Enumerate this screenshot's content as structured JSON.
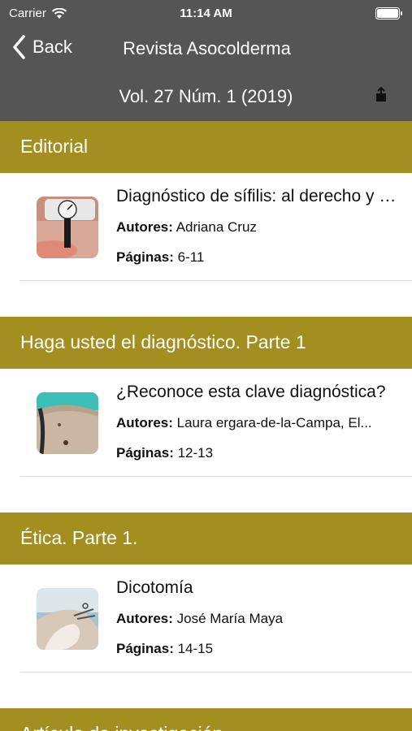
{
  "status_bar": {
    "carrier": "Carrier",
    "time": "11:14 AM"
  },
  "nav": {
    "back_label": "Back",
    "title": "Revista Asocolderma"
  },
  "issue": {
    "title": "Vol. 27 Núm. 1 (2019)"
  },
  "labels": {
    "authors": "Autores:",
    "pages": "Páginas:"
  },
  "sections": [
    {
      "title": "Editorial",
      "article": {
        "title": "Diagnóstico de sífilis: al derecho y al revés",
        "authors": "Adriana Cruz",
        "pages": "6-11"
      }
    },
    {
      "title": "Haga usted el diagnóstico. Parte 1",
      "article": {
        "title": "¿Reconoce esta clave diagnóstica?",
        "authors": "Laura ergara-de-la-Campa, El...",
        "pages": "12-13"
      }
    },
    {
      "title": "Ética. Parte 1.",
      "article": {
        "title": "Dicotomía",
        "authors": "José María Maya",
        "pages": "14-15"
      }
    },
    {
      "title": "Artículo de investigación"
    }
  ],
  "colors": {
    "header_bg": "#555555",
    "section_bg": "#a38e1f"
  }
}
